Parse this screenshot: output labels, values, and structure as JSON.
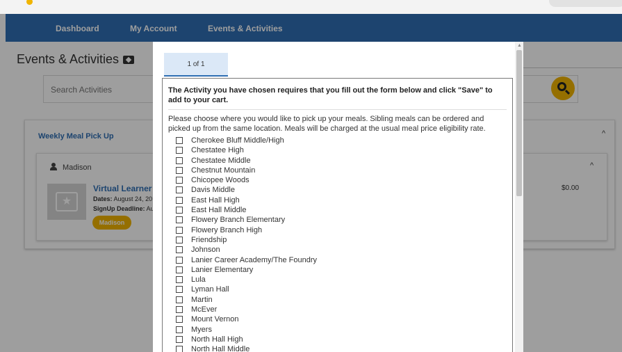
{
  "nav": {
    "items": [
      {
        "label": "Dashboard"
      },
      {
        "label": "My Account"
      },
      {
        "label": "Events & Activities"
      }
    ]
  },
  "page": {
    "title": "Events & Activities",
    "search_placeholder": "Search Activities"
  },
  "card": {
    "title": "Weekly Meal Pick Up",
    "person": "Madison",
    "activity_title": "Virtual Learner W",
    "dates_label": "Dates:",
    "dates_value": "August 24, 20",
    "signup_label": "SignUp Deadline:",
    "signup_value": "Au",
    "badge": "Madison",
    "price": "$0.00"
  },
  "modal": {
    "tab_label": "1 of 1",
    "intro": "The Activity you have chosen requires that you fill out the form below and click \"Save\" to add to your cart.",
    "description": "Please choose where you would like to pick up your meals. Sibling meals can be ordered and picked up from the same location. Meals will be charged at the usual meal price eligibility rate.",
    "options": [
      "Cherokee Bluff Middle/High",
      "Chestatee High",
      "Chestatee Middle",
      "Chestnut Mountain",
      "Chicopee Woods",
      "Davis Middle",
      "East Hall High",
      "East Hall Middle",
      "Flowery Branch Elementary",
      "Flowery Branch High",
      "Friendship",
      "Johnson",
      "Lanier Career Academy/The Foundry",
      "Lanier Elementary",
      "Lula",
      "Lyman Hall",
      "Martin",
      "McEver",
      "Mount Vernon",
      "Myers",
      "North Hall High",
      "North Hall Middle"
    ]
  }
}
